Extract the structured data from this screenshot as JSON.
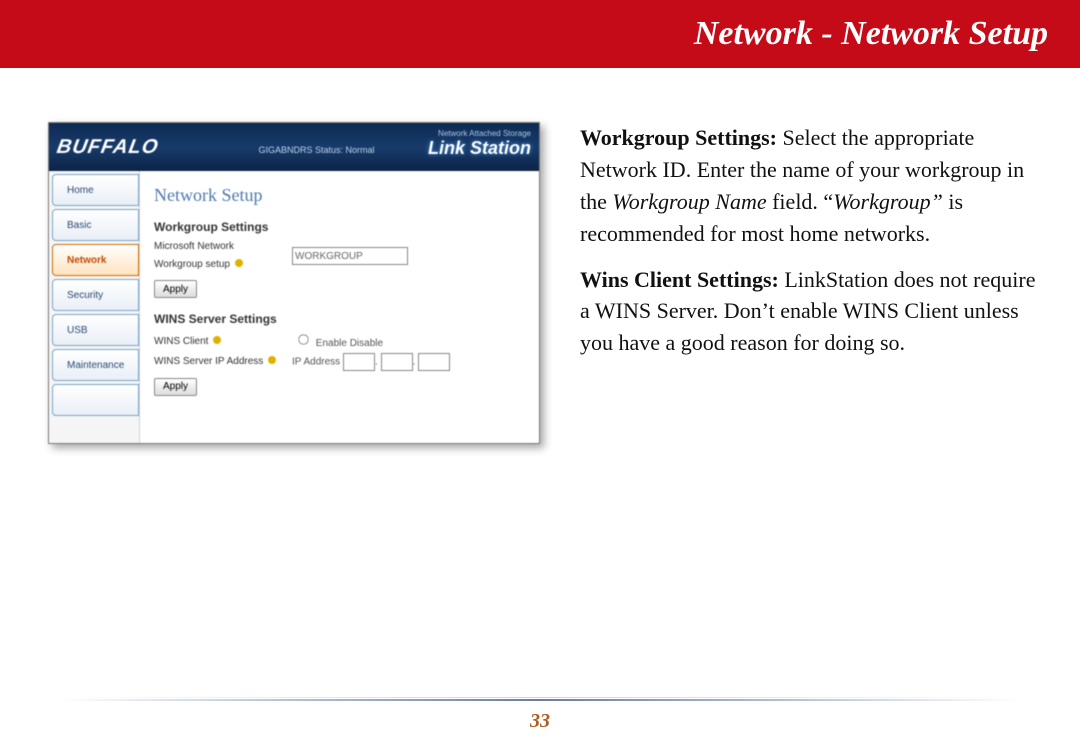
{
  "banner": {
    "title": "Network - Network Setup"
  },
  "manual": {
    "p1_bold": "Workgroup Settings:",
    "p1_rest_a": "  Select the appropriate Network ID.  Enter the name of your workgroup in the ",
    "p1_italic1": "Workgroup Name",
    "p1_rest_b": " field. “",
    "p1_italic2": "Workgroup”",
    "p1_rest_c": " is recommended for most home networks.",
    "p2_bold": "Wins Client Settings:",
    "p2_rest": "  LinkStation does not require a WINS Server.  Don’t enable WINS Client unless you have a good reason for doing so."
  },
  "screenshot": {
    "brand": "BUFFALO",
    "status_text": "GIGABNDRS Status: Normal",
    "product_small": "Network Attached Storage",
    "product_big": "Link Station",
    "sidebar": {
      "items": [
        "Home",
        "Basic",
        "Network",
        "Security",
        "USB",
        "Maintenance",
        ""
      ]
    },
    "panel": {
      "title": "Network Setup",
      "workgroup_heading": "Workgroup Settings",
      "workgroup_label": "Microsoft Network Workgroup setup",
      "workgroup_value": "WORKGROUP",
      "apply": "Apply",
      "wins_heading": "WINS Server Settings",
      "wins_client_label": "WINS Client",
      "wins_client_radio": "Enable  Disable",
      "wins_ip_label": "WINS Server IP Address",
      "wins_ip_prefix": "IP Address"
    }
  },
  "page_number": "33"
}
